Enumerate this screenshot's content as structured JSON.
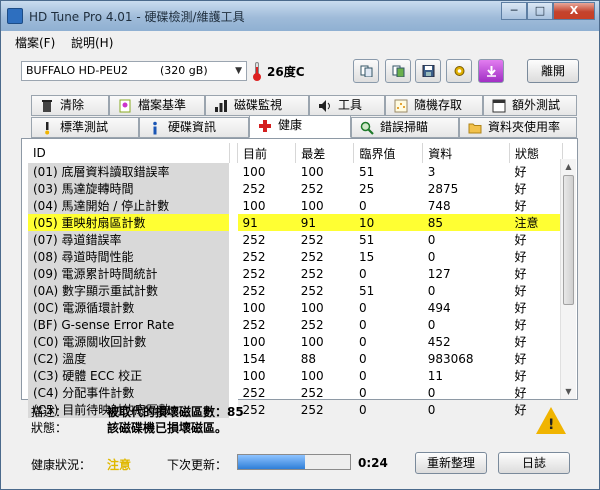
{
  "window": {
    "title": "HD Tune Pro 4.01 - 硬碟檢測/維護工具",
    "buttons": {
      "minimize": "─",
      "maximize": "□",
      "close": "X"
    }
  },
  "menu": {
    "items": [
      "檔案(F)",
      "說明(H)"
    ]
  },
  "toolbar": {
    "drive_name": "BUFFALO HD-PEU2",
    "drive_size": "(320 gB)",
    "temperature": "26度C",
    "icons": [
      "copy-text-icon",
      "copy-screenshot-icon",
      "save-icon",
      "options-icon",
      "download-icon"
    ],
    "exit_label": "離開"
  },
  "tabs_top": [
    {
      "label": "清除",
      "icon": "trash-icon"
    },
    {
      "label": "檔案基準",
      "icon": "file-benchmark-icon"
    },
    {
      "label": "磁碟監視",
      "icon": "bar-chart-icon"
    },
    {
      "label": "工具",
      "icon": "speaker-icon"
    },
    {
      "label": "隨機存取",
      "icon": "random-access-icon"
    },
    {
      "label": "額外測試",
      "icon": "extra-tests-icon"
    }
  ],
  "tabs_bottom": [
    {
      "label": "標準測試",
      "icon": "benchmark-icon"
    },
    {
      "label": "硬碟資訊",
      "icon": "info-icon"
    },
    {
      "label": "健康",
      "icon": "health-cross-icon",
      "active": true
    },
    {
      "label": "錯誤掃瞄",
      "icon": "magnifier-icon"
    },
    {
      "label": "資料夾使用率",
      "icon": "folder-icon"
    }
  ],
  "table": {
    "headers": [
      "ID",
      "目前",
      "最差",
      "臨界值",
      "資料",
      "狀態"
    ],
    "rows": [
      [
        "(01) 底層資料讀取錯誤率",
        "100",
        "100",
        "51",
        "3",
        "好"
      ],
      [
        "(03) 馬達旋轉時間",
        "252",
        "252",
        "25",
        "2875",
        "好"
      ],
      [
        "(04) 馬達開始 / 停止計數",
        "100",
        "100",
        "0",
        "748",
        "好"
      ],
      [
        "(05) 重映射扇區計數",
        "91",
        "91",
        "10",
        "85",
        "注意"
      ],
      [
        "(07) 尋道錯誤率",
        "252",
        "252",
        "51",
        "0",
        "好"
      ],
      [
        "(08) 尋道時間性能",
        "252",
        "252",
        "15",
        "0",
        "好"
      ],
      [
        "(09) 電源累計時間統計",
        "252",
        "252",
        "0",
        "127",
        "好"
      ],
      [
        "(0A) 數字顯示重試計數",
        "252",
        "252",
        "51",
        "0",
        "好"
      ],
      [
        "(0C) 電源循環計數",
        "100",
        "100",
        "0",
        "494",
        "好"
      ],
      [
        "(BF) G-sense Error Rate",
        "252",
        "252",
        "0",
        "0",
        "好"
      ],
      [
        "(C0) 電源關收回計數",
        "100",
        "100",
        "0",
        "452",
        "好"
      ],
      [
        "(C2) 溫度",
        "154",
        "88",
        "0",
        "983068",
        "好"
      ],
      [
        "(C3) 硬體 ECC 校正",
        "100",
        "100",
        "0",
        "11",
        "好"
      ],
      [
        "(C4) 分配事件計數",
        "252",
        "252",
        "0",
        "0",
        "好"
      ],
      [
        "(C5) 目前待映射的扇區數",
        "252",
        "252",
        "0",
        "0",
        "好"
      ]
    ],
    "warning_row_index": 3
  },
  "description": {
    "desc_label": "描述：",
    "desc_value": "被取代的損壞磁區數：85",
    "status_label": "狀態：",
    "status_value": "該磁碟機已損壞磁區。"
  },
  "statusbar": {
    "health_label": "健康狀況：",
    "health_value": "注意",
    "next_update_label": "下次更新：",
    "progress_fraction": 0.6,
    "countdown": "0:24",
    "refresh_label": "重新整理",
    "log_label": "日誌"
  },
  "colors": {
    "warning_row": "#ffff33",
    "health_value": "#e0b800"
  }
}
